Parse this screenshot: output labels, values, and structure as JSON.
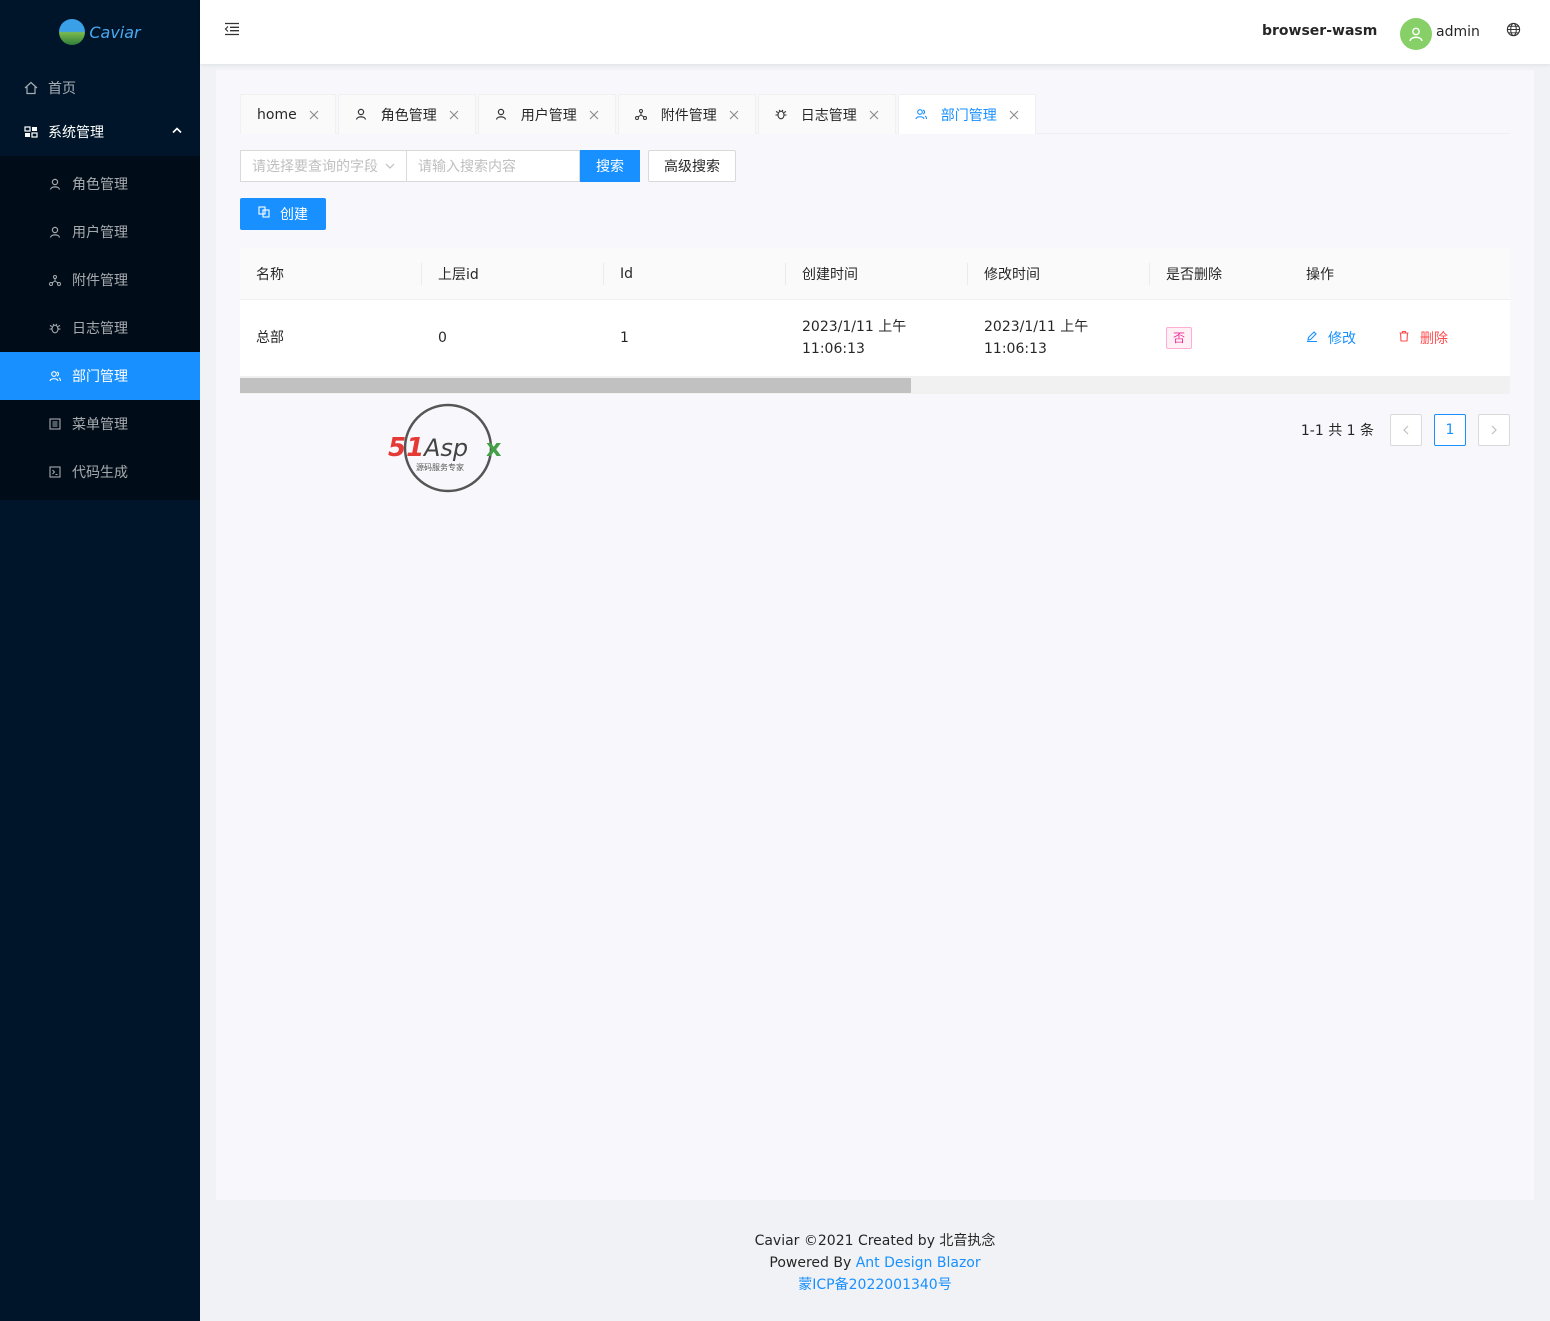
{
  "app": {
    "logo_text": "Caviar"
  },
  "sidebar": {
    "items": [
      {
        "label": "首页",
        "icon": "home-icon"
      },
      {
        "label": "系统管理",
        "icon": "appstore-icon",
        "expanded": true
      }
    ],
    "sub_items": [
      {
        "label": "角色管理",
        "icon": "user-icon"
      },
      {
        "label": "用户管理",
        "icon": "user-icon"
      },
      {
        "label": "附件管理",
        "icon": "apartment-icon"
      },
      {
        "label": "日志管理",
        "icon": "bug-icon"
      },
      {
        "label": "部门管理",
        "icon": "team-icon",
        "active": true
      },
      {
        "label": "菜单管理",
        "icon": "profile-icon"
      },
      {
        "label": "代码生成",
        "icon": "code-icon"
      }
    ]
  },
  "header": {
    "env": "browser-wasm",
    "user": "admin"
  },
  "tabs": [
    {
      "label": "home"
    },
    {
      "label": "角色管理",
      "icon": "user-icon"
    },
    {
      "label": "用户管理",
      "icon": "user-icon"
    },
    {
      "label": "附件管理",
      "icon": "apartment-icon"
    },
    {
      "label": "日志管理",
      "icon": "bug-icon"
    },
    {
      "label": "部门管理",
      "icon": "team-icon",
      "active": true
    }
  ],
  "search": {
    "field_placeholder": "请选择要查询的字段",
    "input_placeholder": "请输入搜索内容",
    "search_label": "搜索",
    "advanced_label": "高级搜索"
  },
  "create_label": "创建",
  "table": {
    "columns": [
      "名称",
      "上层id",
      "Id",
      "创建时间",
      "修改时间",
      "是否删除",
      "操作"
    ],
    "rows": [
      {
        "name": "总部",
        "parent_id": "0",
        "id": "1",
        "created_line1": "2023/1/11 上午",
        "created_line2": "11:06:13",
        "modified_line1": "2023/1/11 上午",
        "modified_line2": "11:06:13",
        "deleted": "否",
        "edit_label": "修改",
        "delete_label": "删除"
      }
    ]
  },
  "pagination": {
    "total_text": "1-1 共 1 条",
    "current_page": "1"
  },
  "watermark": {
    "brand": "51Aspx",
    "tagline": "源码服务专家"
  },
  "footer": {
    "line1": "Caviar ©2021 Created by 北音执念",
    "powered_prefix": "Powered By ",
    "powered_link": "Ant Design Blazor",
    "icp": "蒙ICP备2022001340号"
  },
  "colors": {
    "primary": "#1890ff",
    "sider": "#001529",
    "danger": "#ff4d4f",
    "tag_magenta": "#eb2f96"
  }
}
